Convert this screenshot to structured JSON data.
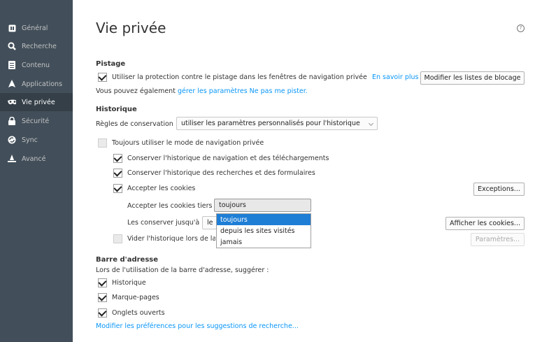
{
  "sidebar": {
    "items": [
      {
        "label": "Général",
        "icon": "general-icon"
      },
      {
        "label": "Recherche",
        "icon": "search-icon"
      },
      {
        "label": "Contenu",
        "icon": "document-icon"
      },
      {
        "label": "Applications",
        "icon": "rocket-icon"
      },
      {
        "label": "Vie privée",
        "icon": "mask-icon",
        "active": true
      },
      {
        "label": "Sécurité",
        "icon": "lock-icon"
      },
      {
        "label": "Sync",
        "icon": "sync-icon"
      },
      {
        "label": "Avancé",
        "icon": "wizard-icon"
      }
    ]
  },
  "page": {
    "title": "Vie privée",
    "help": "?"
  },
  "tracking": {
    "heading": "Pistage",
    "checkbox_label": "Utiliser la protection contre le pistage dans les fenêtres de navigation privée",
    "learn_more": "En savoir plus",
    "block_lists_button": "Modifier les listes de blocage",
    "dnt_prefix": "Vous pouvez également ",
    "dnt_link": "gérer les paramètres Ne pas me pister."
  },
  "history": {
    "heading": "Historique",
    "rules_label": "Règles de conservation :",
    "rules_value": "utiliser les paramètres personnalisés pour l'historique",
    "always_private": "Toujours utiliser le mode de navigation privée",
    "keep_browsing": "Conserver l'historique de navigation et des téléchargements",
    "keep_search": "Conserver l'historique des recherches et des formulaires",
    "accept_cookies": "Accepter les cookies",
    "exceptions_button": "Exceptions...",
    "third_party_label": "Accepter les cookies tiers :",
    "third_party_value": "toujours",
    "third_party_options": [
      "toujours",
      "depuis les sites visités",
      "jamais"
    ],
    "keep_until_label": "Les conserver jusqu'à :",
    "keep_until_value": "le",
    "show_cookies_button": "Afficher les cookies...",
    "clear_on_close": "Vider l'historique lors de la",
    "settings_button": "Paramètres..."
  },
  "addressbar": {
    "heading": "Barre d'adresse",
    "subtitle": "Lors de l'utilisation de la barre d'adresse, suggérer :",
    "history": "Historique",
    "bookmarks": "Marque-pages",
    "open_tabs": "Onglets ouverts",
    "search_suggestions_link": "Modifier les préférences pour les suggestions de recherche..."
  }
}
